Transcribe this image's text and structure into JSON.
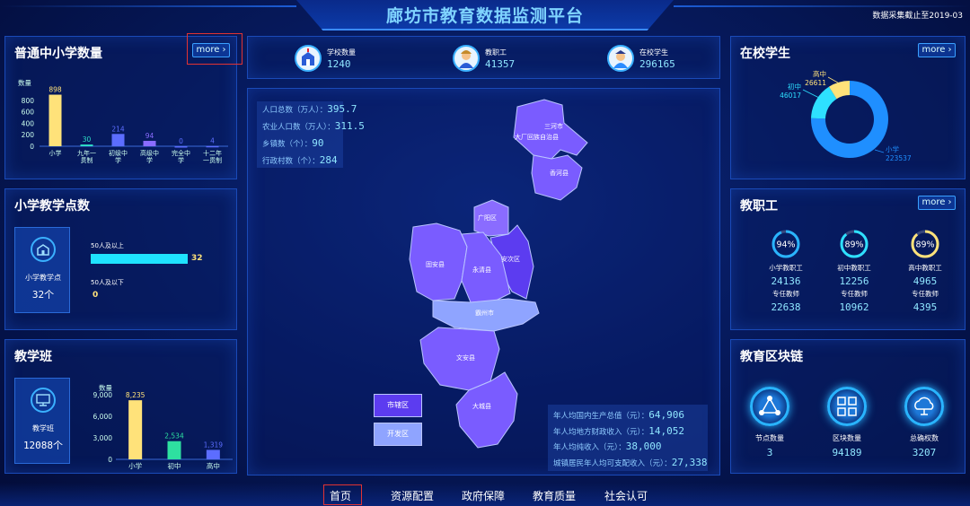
{
  "header": {
    "title": "廊坊市教育数据监测平台",
    "stamp": "数据采集截止至2019-03"
  },
  "summary": [
    {
      "label": "学校数量",
      "value": "1240",
      "icon": "school-icon"
    },
    {
      "label": "教职工",
      "value": "41357",
      "icon": "teacher-icon"
    },
    {
      "label": "在校学生",
      "value": "296165",
      "icon": "student-icon"
    }
  ],
  "panel_schools": {
    "title": "普通中小学数量",
    "more": "more ›",
    "ylabel": "数量",
    "chart_data": {
      "type": "bar",
      "categories": [
        "小学",
        "九年一贯制",
        "初级中学",
        "高级中学",
        "完全中学",
        "十二年一贯制"
      ],
      "values": [
        898,
        30,
        214,
        94,
        0,
        4
      ],
      "ylim": [
        0,
        1000
      ],
      "yticks": [
        0,
        200,
        400,
        600,
        800
      ],
      "colors": [
        "#ffe27a",
        "#2ee0c8",
        "#5c6dff",
        "#8a6cff",
        "#5c6dff",
        "#5c6dff"
      ]
    },
    "cat_labels": [
      "小学",
      "九年一\n贯制",
      "初级中\n学",
      "高级中\n学",
      "完全中\n学",
      "十二年\n一贯制"
    ]
  },
  "panel_points": {
    "title": "小学教学点数",
    "tile_label": "小学教学点",
    "tile_value": "32个",
    "bar1_label": "50人及以上",
    "bar1_value": "32",
    "bar2_label": "50人及以下",
    "bar2_value": "0"
  },
  "panel_classes": {
    "title": "教学班",
    "tile_label": "教学班",
    "tile_value": "12088个",
    "ylabel": "数量",
    "chart_data": {
      "type": "bar",
      "categories": [
        "小学",
        "初中",
        "高中"
      ],
      "values": [
        8235,
        2534,
        1319
      ],
      "value_labels": [
        "8,235",
        "2,534",
        "1,319"
      ],
      "ylim": [
        0,
        9000
      ],
      "yticks": [
        0,
        3000,
        6000,
        9000
      ],
      "ytick_labels": [
        "0",
        "3,000",
        "6,000",
        "9,000"
      ],
      "colors": [
        "#ffe27a",
        "#2ee0a0",
        "#5c6dff"
      ]
    }
  },
  "map": {
    "info": [
      {
        "label": "人口总数（万人）：",
        "value": "395.7"
      },
      {
        "label": "农业人口数（万人）：",
        "value": "311.5"
      },
      {
        "label": "乡镇数（个）：",
        "value": "90"
      },
      {
        "label": "行政村数（个）：",
        "value": "284"
      }
    ],
    "regions": [
      "三河市",
      "大厂回族自治县",
      "香河县",
      "广阳区",
      "安次区",
      "固安县",
      "永清县",
      "霸州市",
      "文安县",
      "大城县"
    ],
    "legend": [
      "市辖区",
      "开发区"
    ],
    "econ": [
      {
        "label": "年人均国内生产总值（元）：",
        "value": "64,906"
      },
      {
        "label": "年人均地方财政收入（元）：",
        "value": "14,052"
      },
      {
        "label": "年人均纯收入（元）：",
        "value": "38,000"
      },
      {
        "label": "城镇居民年人均可支配收入（元）：",
        "value": "27,338"
      }
    ]
  },
  "panel_students": {
    "title": "在校学生",
    "more": "more ›",
    "chart_data": {
      "type": "pie",
      "labels": [
        "小学",
        "初中",
        "高中"
      ],
      "values": [
        223537,
        46017,
        26611
      ],
      "colors": [
        "#1f8fff",
        "#2ee0ff",
        "#ffe27a"
      ]
    }
  },
  "panel_staff": {
    "title": "教职工",
    "more": "more ›",
    "items": [
      {
        "pct": "94%",
        "percent": 94,
        "label": "小学教职工",
        "count": "24136",
        "sub": "专任教师",
        "sub_count": "22638",
        "color": "#29b4ff"
      },
      {
        "pct": "89%",
        "percent": 89,
        "label": "初中教职工",
        "count": "12256",
        "sub": "专任教师",
        "sub_count": "10962",
        "color": "#2ee0ff"
      },
      {
        "pct": "89%",
        "percent": 89,
        "label": "高中教职工",
        "count": "4965",
        "sub": "专任教师",
        "sub_count": "4395",
        "color": "#ffe27a"
      }
    ]
  },
  "panel_chain": {
    "title": "教育区块链",
    "items": [
      {
        "label": "节点数量",
        "value": "3",
        "icon": "node-icon"
      },
      {
        "label": "区块数量",
        "value": "94189",
        "icon": "block-icon"
      },
      {
        "label": "总确权数",
        "value": "3207",
        "icon": "cloud-icon"
      }
    ]
  },
  "nav": [
    "首页",
    "资源配置",
    "政府保障",
    "教育质量",
    "社会认可"
  ]
}
